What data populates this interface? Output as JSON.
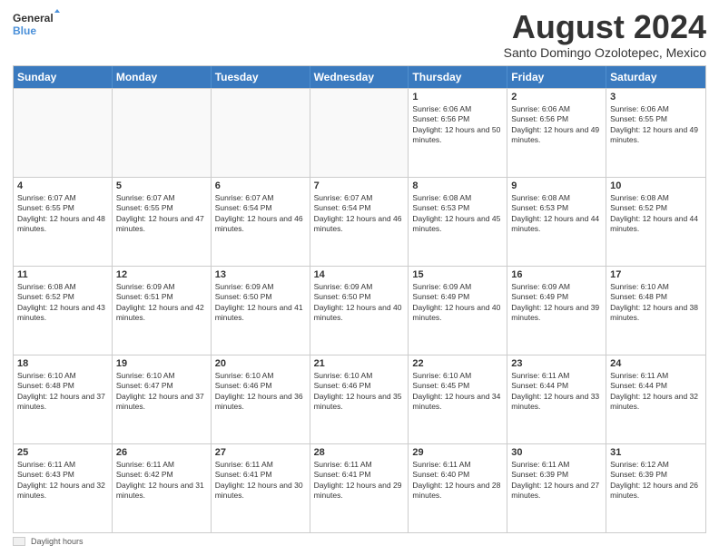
{
  "logo": {
    "general": "General",
    "blue": "Blue"
  },
  "title": "August 2024",
  "location": "Santo Domingo Ozolotepec, Mexico",
  "days_of_week": [
    "Sunday",
    "Monday",
    "Tuesday",
    "Wednesday",
    "Thursday",
    "Friday",
    "Saturday"
  ],
  "weeks": [
    [
      {
        "day": "",
        "empty": true
      },
      {
        "day": "",
        "empty": true
      },
      {
        "day": "",
        "empty": true
      },
      {
        "day": "",
        "empty": true
      },
      {
        "day": "1",
        "sunrise": "6:06 AM",
        "sunset": "6:56 PM",
        "daylight": "12 hours and 50 minutes."
      },
      {
        "day": "2",
        "sunrise": "6:06 AM",
        "sunset": "6:56 PM",
        "daylight": "12 hours and 49 minutes."
      },
      {
        "day": "3",
        "sunrise": "6:06 AM",
        "sunset": "6:55 PM",
        "daylight": "12 hours and 49 minutes."
      }
    ],
    [
      {
        "day": "4",
        "sunrise": "6:07 AM",
        "sunset": "6:55 PM",
        "daylight": "12 hours and 48 minutes."
      },
      {
        "day": "5",
        "sunrise": "6:07 AM",
        "sunset": "6:55 PM",
        "daylight": "12 hours and 47 minutes."
      },
      {
        "day": "6",
        "sunrise": "6:07 AM",
        "sunset": "6:54 PM",
        "daylight": "12 hours and 46 minutes."
      },
      {
        "day": "7",
        "sunrise": "6:07 AM",
        "sunset": "6:54 PM",
        "daylight": "12 hours and 46 minutes."
      },
      {
        "day": "8",
        "sunrise": "6:08 AM",
        "sunset": "6:53 PM",
        "daylight": "12 hours and 45 minutes."
      },
      {
        "day": "9",
        "sunrise": "6:08 AM",
        "sunset": "6:53 PM",
        "daylight": "12 hours and 44 minutes."
      },
      {
        "day": "10",
        "sunrise": "6:08 AM",
        "sunset": "6:52 PM",
        "daylight": "12 hours and 44 minutes."
      }
    ],
    [
      {
        "day": "11",
        "sunrise": "6:08 AM",
        "sunset": "6:52 PM",
        "daylight": "12 hours and 43 minutes."
      },
      {
        "day": "12",
        "sunrise": "6:09 AM",
        "sunset": "6:51 PM",
        "daylight": "12 hours and 42 minutes."
      },
      {
        "day": "13",
        "sunrise": "6:09 AM",
        "sunset": "6:50 PM",
        "daylight": "12 hours and 41 minutes."
      },
      {
        "day": "14",
        "sunrise": "6:09 AM",
        "sunset": "6:50 PM",
        "daylight": "12 hours and 40 minutes."
      },
      {
        "day": "15",
        "sunrise": "6:09 AM",
        "sunset": "6:49 PM",
        "daylight": "12 hours and 40 minutes."
      },
      {
        "day": "16",
        "sunrise": "6:09 AM",
        "sunset": "6:49 PM",
        "daylight": "12 hours and 39 minutes."
      },
      {
        "day": "17",
        "sunrise": "6:10 AM",
        "sunset": "6:48 PM",
        "daylight": "12 hours and 38 minutes."
      }
    ],
    [
      {
        "day": "18",
        "sunrise": "6:10 AM",
        "sunset": "6:48 PM",
        "daylight": "12 hours and 37 minutes."
      },
      {
        "day": "19",
        "sunrise": "6:10 AM",
        "sunset": "6:47 PM",
        "daylight": "12 hours and 37 minutes."
      },
      {
        "day": "20",
        "sunrise": "6:10 AM",
        "sunset": "6:46 PM",
        "daylight": "12 hours and 36 minutes."
      },
      {
        "day": "21",
        "sunrise": "6:10 AM",
        "sunset": "6:46 PM",
        "daylight": "12 hours and 35 minutes."
      },
      {
        "day": "22",
        "sunrise": "6:10 AM",
        "sunset": "6:45 PM",
        "daylight": "12 hours and 34 minutes."
      },
      {
        "day": "23",
        "sunrise": "6:11 AM",
        "sunset": "6:44 PM",
        "daylight": "12 hours and 33 minutes."
      },
      {
        "day": "24",
        "sunrise": "6:11 AM",
        "sunset": "6:44 PM",
        "daylight": "12 hours and 32 minutes."
      }
    ],
    [
      {
        "day": "25",
        "sunrise": "6:11 AM",
        "sunset": "6:43 PM",
        "daylight": "12 hours and 32 minutes."
      },
      {
        "day": "26",
        "sunrise": "6:11 AM",
        "sunset": "6:42 PM",
        "daylight": "12 hours and 31 minutes."
      },
      {
        "day": "27",
        "sunrise": "6:11 AM",
        "sunset": "6:41 PM",
        "daylight": "12 hours and 30 minutes."
      },
      {
        "day": "28",
        "sunrise": "6:11 AM",
        "sunset": "6:41 PM",
        "daylight": "12 hours and 29 minutes."
      },
      {
        "day": "29",
        "sunrise": "6:11 AM",
        "sunset": "6:40 PM",
        "daylight": "12 hours and 28 minutes."
      },
      {
        "day": "30",
        "sunrise": "6:11 AM",
        "sunset": "6:39 PM",
        "daylight": "12 hours and 27 minutes."
      },
      {
        "day": "31",
        "sunrise": "6:12 AM",
        "sunset": "6:39 PM",
        "daylight": "12 hours and 26 minutes."
      }
    ]
  ],
  "legend": {
    "daylight_label": "Daylight hours"
  }
}
